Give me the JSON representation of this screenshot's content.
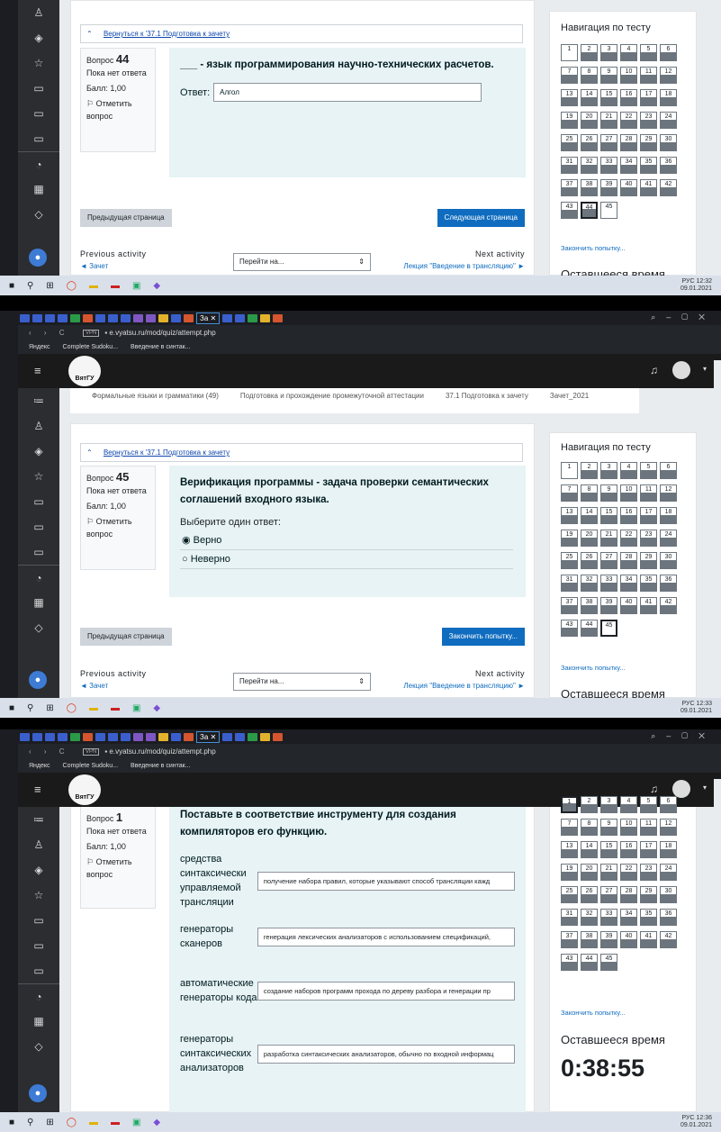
{
  "browser": {
    "url": "e.vyatsu.ru/mod/quiz/attempt.php",
    "active_tab": "За",
    "bookmarks": [
      "Яндекс",
      "Complete Sudoku...",
      "Введение в синтак..."
    ]
  },
  "site": {
    "logo_text": "ВятГУ"
  },
  "breadcrumb": [
    "Формальные языки и грамматики (49)",
    "Подготовка и прохождение промежуточной аттестации",
    "37.1 Подготовка к зачету",
    "Зачет_2021"
  ],
  "back_link": "Вернуться к '37.1 Подготовка к зачету",
  "common": {
    "status": "Пока нет ответа",
    "grade": "Балл: 1,00",
    "flag": "Отметить вопрос",
    "prev_btn": "Предыдущая страница",
    "prev_activity": "Previous activity",
    "next_activity": "Next activity",
    "prev_link": "◄ Зачет",
    "next_link": "Лекция \"Введение в трансляцию\" ►",
    "jump": "Перейти на...",
    "nav_title": "Навигация по тесту",
    "finish": "Закончить попытку...",
    "time_label": "Оставшееся время"
  },
  "q44": {
    "label": "Вопрос",
    "num": "44",
    "text": "___ - язык программирования научно-технических расчетов.",
    "answer_label": "Ответ:",
    "answer": "Алгол",
    "next_btn": "Следующая страница"
  },
  "q45": {
    "label": "Вопрос",
    "num": "45",
    "text": "Верификация программы - задача проверки семантических соглашений входного языка.",
    "choose": "Выберите один ответ:",
    "opt1": "Верно",
    "opt2": "Неверно",
    "next_btn": "Закончить попытку..."
  },
  "q1": {
    "label": "Вопрос",
    "num": "1",
    "text": "Поставьте в соответствие инструменту для создания компиляторов его функцию.",
    "rows": [
      {
        "label": "средства синтаксически управляемой трансляции",
        "value": "получение набора правил, которые указывают способ трансляции кажд"
      },
      {
        "label": "генераторы сканеров",
        "value": "генерация лексических анализаторов с использованием спецификаций,"
      },
      {
        "label": "автоматические генераторы кода",
        "value": "создание наборов программ прохода по дереву разбора и генерации пр"
      },
      {
        "label": "генераторы синтаксических анализаторов",
        "value": "разработка синтаксических анализаторов, обычно по входной информац"
      }
    ]
  },
  "timer": "0:38:55",
  "taskbar": [
    {
      "time": "12:32",
      "date": "09.01.2021",
      "lang": "РУС"
    },
    {
      "time": "12:33",
      "date": "09.01.2021",
      "lang": "РУС"
    },
    {
      "time": "12:36",
      "date": "09.01.2021",
      "lang": "РУС"
    }
  ],
  "nav_numbers": [
    "1",
    "2",
    "3",
    "4",
    "5",
    "6",
    "7",
    "8",
    "9",
    "10",
    "11",
    "12",
    "13",
    "14",
    "15",
    "16",
    "17",
    "18",
    "19",
    "20",
    "21",
    "22",
    "23",
    "24",
    "25",
    "26",
    "27",
    "28",
    "29",
    "30",
    "31",
    "32",
    "33",
    "34",
    "35",
    "36",
    "37",
    "38",
    "39",
    "40",
    "41",
    "42",
    "43",
    "44",
    "45"
  ]
}
